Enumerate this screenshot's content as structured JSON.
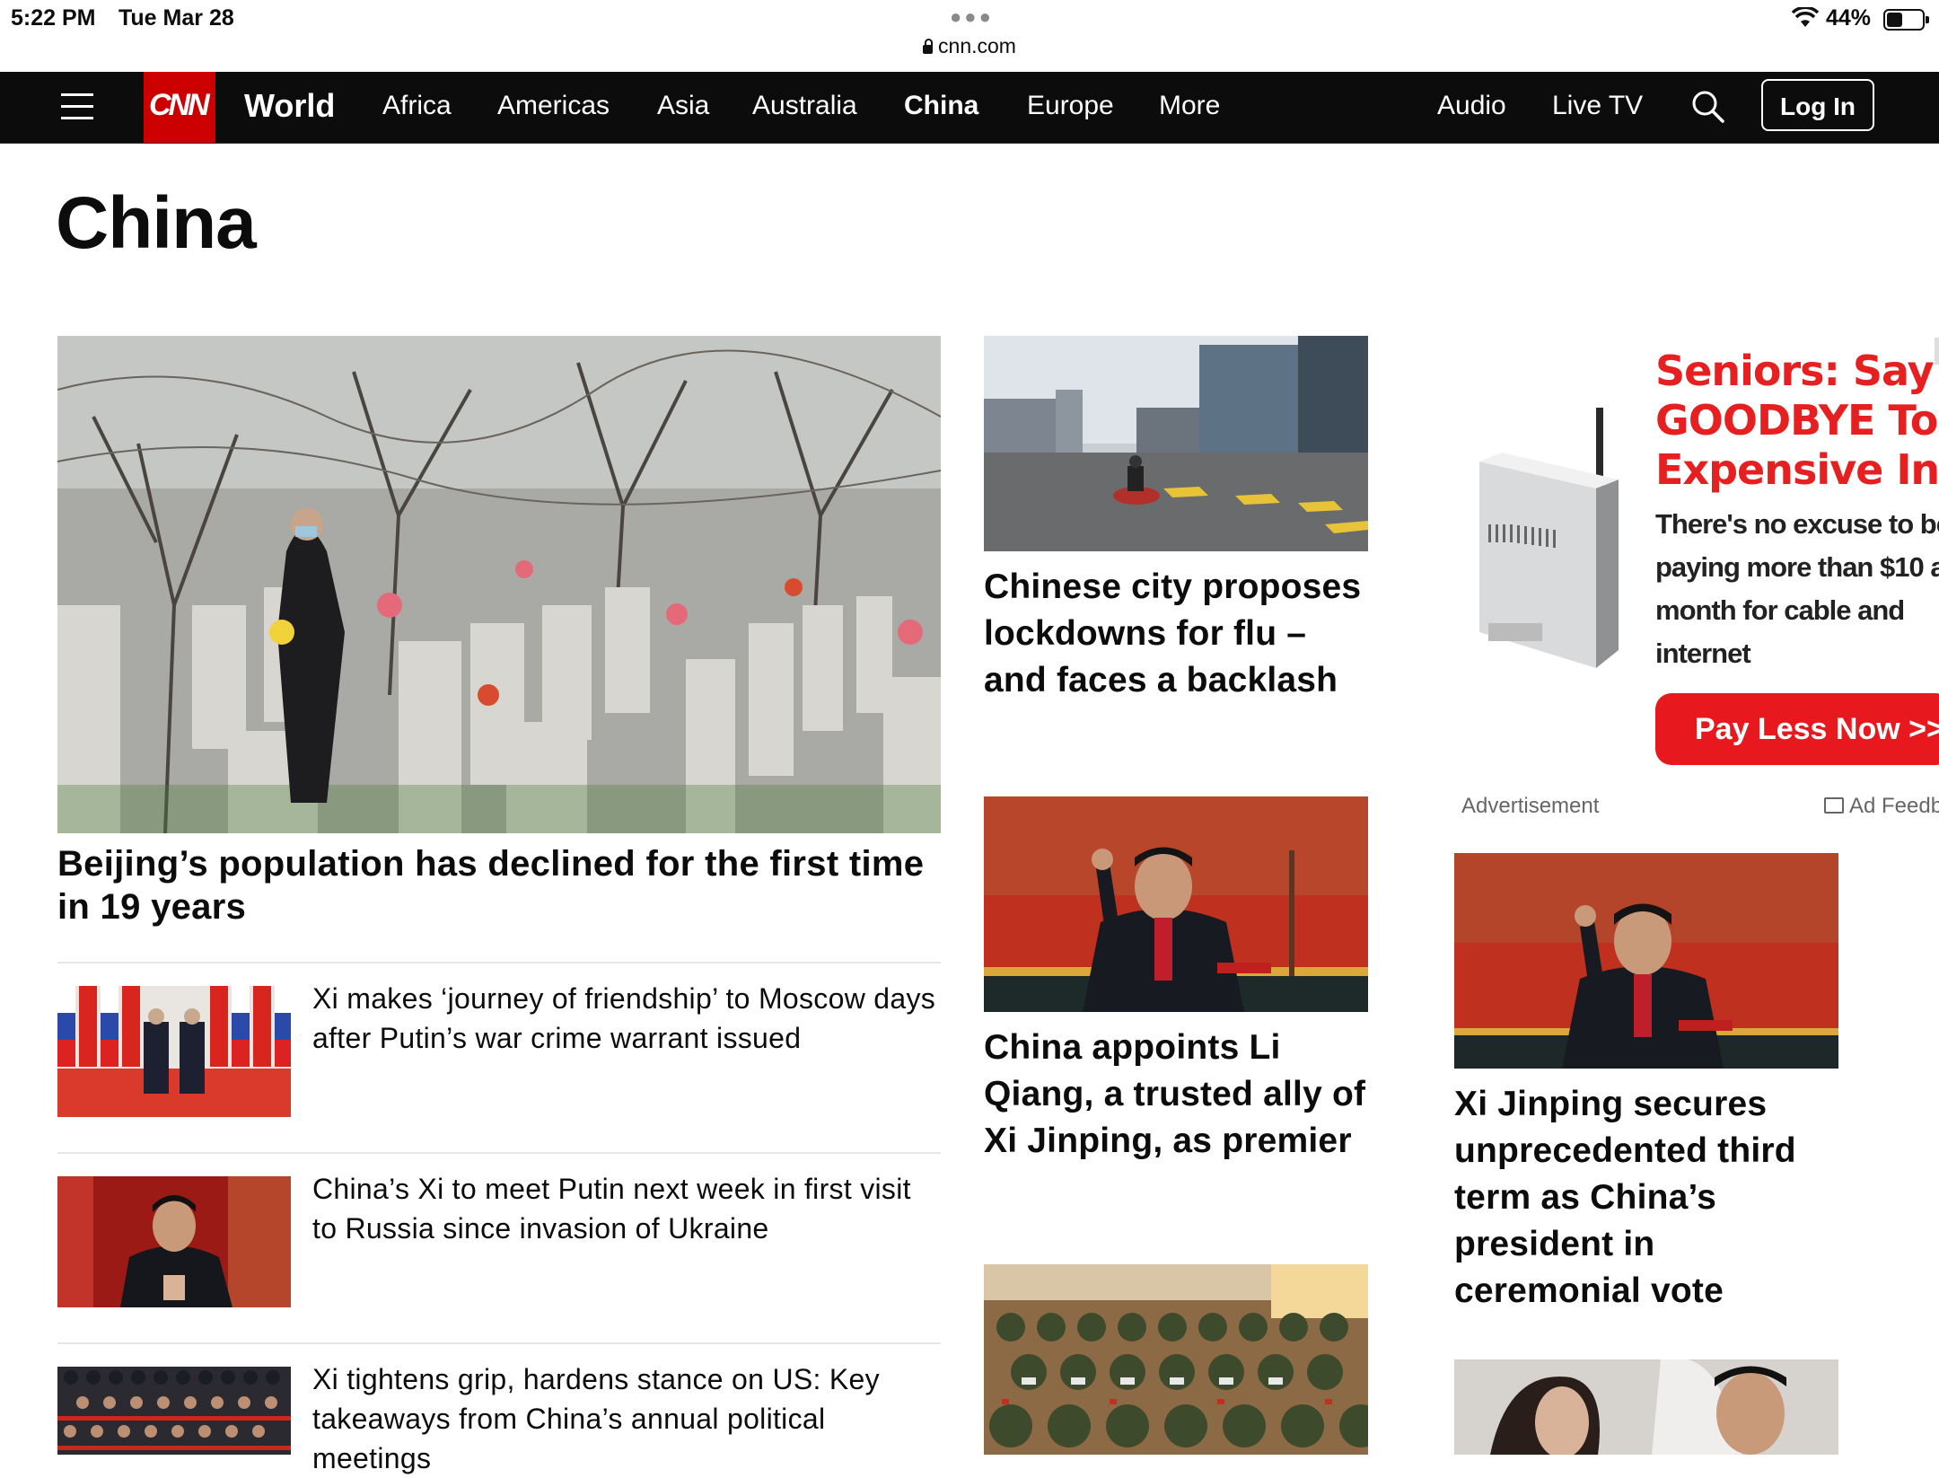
{
  "status_bar": {
    "time": "5:22 PM",
    "date": "Tue Mar 28",
    "url": "cnn.com",
    "battery": "44%"
  },
  "nav": {
    "logo": "CNN",
    "section": "World",
    "items": [
      "Africa",
      "Americas",
      "Asia",
      "Australia",
      "China",
      "Europe",
      "More"
    ],
    "active": "China",
    "right_items": [
      "Audio",
      "Live TV"
    ],
    "login": "Log In",
    "icons": [
      "menu-icon",
      "search-icon"
    ]
  },
  "page_title": "China",
  "lead_story": {
    "headline": "Beijing’s population has declined for the first time in 19 years"
  },
  "list_stories": [
    {
      "headline": "Xi makes ‘journey of friendship’ to Moscow days after Putin’s war crime warrant issued"
    },
    {
      "headline": "China’s Xi to meet Putin next week in first visit to Russia since invasion of Ukraine"
    },
    {
      "headline": "Xi tightens grip, hardens stance on US: Key takeaways from China’s annual political meetings"
    }
  ],
  "middle_cards": [
    {
      "headline": "Chinese city proposes lockdowns for flu – and faces a backlash"
    },
    {
      "headline": "China appoints Li Qiang, a trusted ally of Xi Jinping, as premier"
    }
  ],
  "right_cards": [
    {
      "headline": "Xi Jinping secures unprecedented third term as China’s president in ceremonial vote"
    }
  ],
  "ad": {
    "title_lines": [
      "Seniors: Say",
      "GOODBYE To",
      "Expensive Intern"
    ],
    "body_lines": [
      "There's no excuse to be",
      "paying more than $10 a",
      "month for cable and",
      "internet"
    ],
    "cta": "Pay Less Now >>",
    "label": "Advertisement",
    "feedback": "Ad Feedback"
  },
  "colors": {
    "brand_red": "#cc0000",
    "nav_bg": "#0c0c0c",
    "ad_red": "#e62020"
  }
}
